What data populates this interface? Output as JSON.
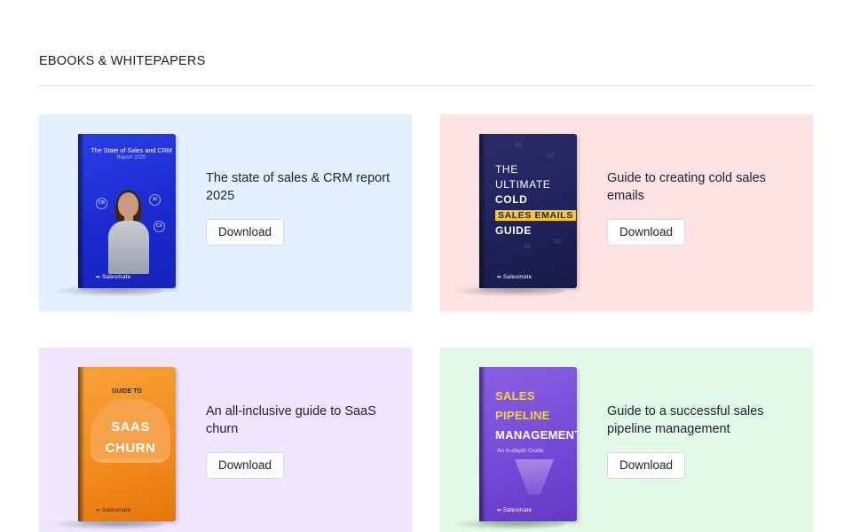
{
  "section": {
    "title": "EBOOKS & WHITEPAPERS"
  },
  "colors": {
    "card_blue": "#e3f0fd",
    "card_pink": "#fde3e3",
    "card_lilac": "#efe5fd",
    "card_green": "#e1f9e6"
  },
  "cards": [
    {
      "title": "The state of sales & CRM report 2025",
      "button": "Download",
      "bg": "#e3f0fd",
      "cover": {
        "title": "The State of Sales and CRM",
        "subtitle": "Report 2025",
        "brand": "Salesmate",
        "bubbles": [
          "DB",
          "AI",
          "CX"
        ]
      }
    },
    {
      "title": "Guide to creating cold sales emails",
      "button": "Download",
      "bg": "#fde3e3",
      "cover": {
        "line1": "THE",
        "line2": "ULTIMATE",
        "line3": "COLD",
        "line4": "SALES EMAILS",
        "line5": "GUIDE",
        "brand": "Salesmate"
      }
    },
    {
      "title": "An all-inclusive guide to SaaS churn",
      "button": "Download",
      "bg": "#efe5fd",
      "cover": {
        "kicker": "GUIDE TO",
        "line1": "SAAS",
        "line2": "CHURN",
        "brand": "Salesmate"
      }
    },
    {
      "title": "Guide to a successful sales pipeline management",
      "button": "Download",
      "bg": "#e1f9e6",
      "cover": {
        "line1": "SALES",
        "line2": "PIPELINE",
        "line3": "MANAGEMENT",
        "subtitle": "An in-depth Guide",
        "brand": "Salesmate"
      }
    }
  ]
}
